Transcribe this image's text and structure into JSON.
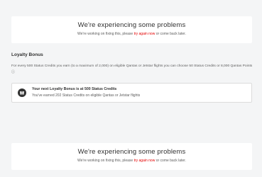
{
  "errors": [
    {
      "title": "We're experiencing some problems",
      "desc_prefix": "We're working on fixing this, please ",
      "link": "try again now",
      "desc_suffix": " or come back later."
    },
    {
      "title": "We're experiencing some problems",
      "desc_prefix": "We're working on fixing this, please ",
      "link": "try again now",
      "desc_suffix": " or come back later."
    }
  ],
  "loyalty": {
    "title": "Loyalty Bonus",
    "description": "For every 500 Status Credits you earn (to a maximum of 2,000) on eligible Qantas or Jetstar flights you can choose 50 Status Credits or 8,000 Qantas Points ⓘ",
    "card": {
      "icon": "gift-icon",
      "heading": "Your next Loyalty Bonus is at 500 Status Credits",
      "text": "You've earned 202 Status Credits on eligible Qantas or Jetstar flights"
    }
  },
  "colors": {
    "background": "#f4f5f6",
    "card": "#ffffff",
    "link": "#e40000",
    "text": "#323232",
    "muted": "#5c5c5c"
  }
}
